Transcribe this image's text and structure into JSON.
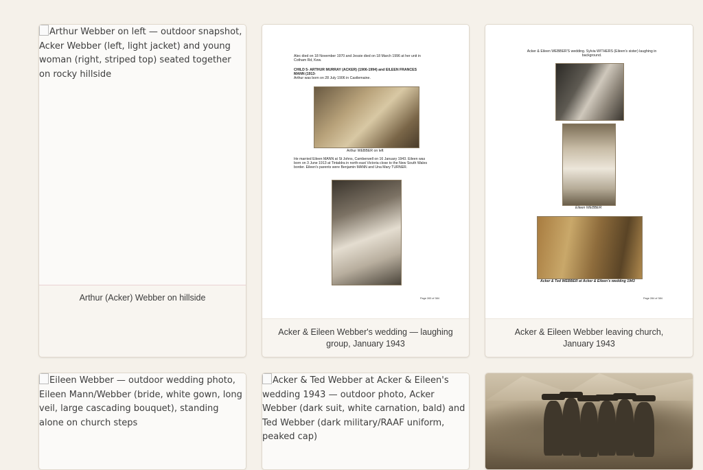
{
  "cards": [
    {
      "alt": "Arthur Webber on left — outdoor snapshot, Acker Webber (left, light jacket) and young woman (right, striped top) seated together on rocky hillside",
      "caption": "Arthur (Acker) Webber on hillside"
    },
    {
      "caption": "Acker & Eileen Webber's wedding — laughing group, January 1943",
      "page": {
        "line1": "Alec died on 18 November 1970 and Jessie died on 18 March 1996 at her unit in",
        "line2": "Cotham Rd, Kew.",
        "heading1": "CHILD 5- ARTHUR MURRAY (ACKER) (1906-1994) and EILEEN FRANCES",
        "heading2": "MANN (1913-",
        "born": "Arthur was born on 28 July 1906 in Castlemaine.",
        "photo_caption": "Arthur WEBBER on left",
        "para1": "He married Eileen MANN at St Johns, Camberwell on 16 January 1943. Eileen was",
        "para2": "born on 3 June 1913 at Tintaldra in north-east Victoria close to the New South Wales",
        "para3": "border. Eileen's parents were Benjamin MANN and Una Mary TURNER.",
        "page_number": "Page 283 of 384"
      }
    },
    {
      "caption": "Acker & Eileen Webber leaving church, January 1943",
      "page": {
        "line1": "Acker & Eileen WEBBER'S wedding. Sylvia WITHERS (Eileen's sister) laughing in",
        "line2": "background.",
        "photo2_caption": "Eileen WEBBER",
        "photo3_caption": "Acker & Ted WEBBER at Acker & Eileen's wedding 1943",
        "page_number": "Page 284 of 384"
      }
    },
    {
      "alt": "Eileen Webber — outdoor wedding photo, Eileen Mann/Webber (bride, white gown, long veil, large cascading bouquet), standing alone on church steps"
    },
    {
      "alt": "Acker & Ted Webber at Acker & Eileen's wedding 1943 — outdoor photo, Acker Webber (dark suit, white carnation, bald) and Ted Webber (dark military/RAAF uniform, peaked cap)"
    },
    {}
  ]
}
